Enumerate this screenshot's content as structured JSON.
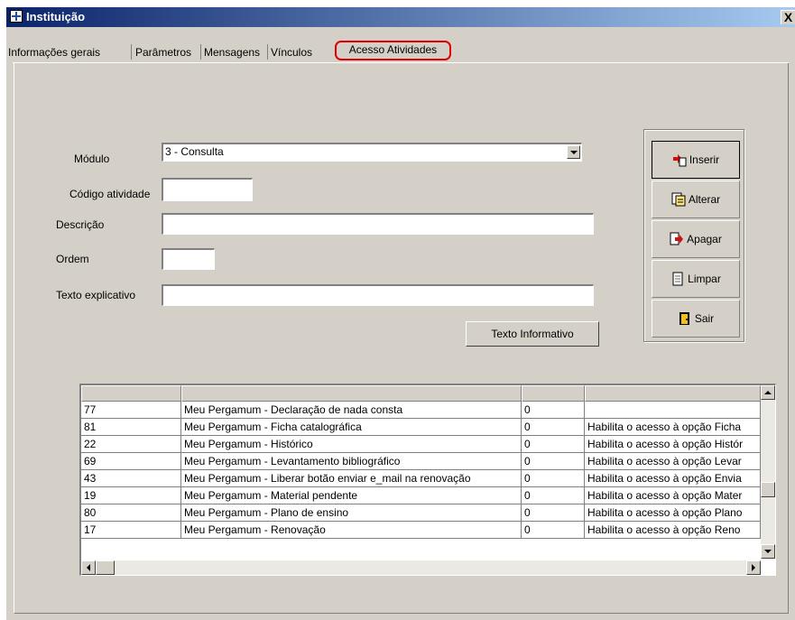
{
  "window": {
    "title": "Instituição",
    "close_label": "X"
  },
  "tabs": [
    {
      "label": "Informações gerais"
    },
    {
      "label": "Parâmetros"
    },
    {
      "label": "Mensagens"
    },
    {
      "label": "Vínculos"
    },
    {
      "label": "Acesso Atividades"
    }
  ],
  "form": {
    "modulo_label": "Módulo",
    "modulo_value": "3 - Consulta",
    "codigo_label": "Código atividade",
    "codigo_value": "",
    "descricao_label": "Descrição",
    "descricao_value": "",
    "ordem_label": "Ordem",
    "ordem_value": "",
    "texto_label": "Texto explicativo",
    "texto_value": "",
    "texto_informativo_button": "Texto Informativo"
  },
  "actions": [
    {
      "label": "Inserir",
      "icon": "insert-icon"
    },
    {
      "label": "Alterar",
      "icon": "edit-icon"
    },
    {
      "label": "Apagar",
      "icon": "delete-icon"
    },
    {
      "label": "Limpar",
      "icon": "clear-icon"
    },
    {
      "label": "Sair",
      "icon": "exit-door-icon"
    }
  ],
  "grid": {
    "headers": [
      "",
      "",
      "",
      ""
    ],
    "rows": [
      [
        "77",
        "Meu Pergamum  - Declaração de nada consta",
        "0",
        ""
      ],
      [
        "81",
        "Meu Pergamum  - Ficha catalográfica",
        "0",
        "Habilita o acesso à opção Ficha"
      ],
      [
        "22",
        "Meu Pergamum  - Histórico",
        "0",
        "Habilita o acesso à opção Histór"
      ],
      [
        "69",
        "Meu Pergamum  - Levantamento bibliográfico",
        "0",
        "Habilita o acesso à opção Levar"
      ],
      [
        "43",
        "Meu Pergamum  - Liberar botão enviar e_mail na renovação",
        "0",
        "Habilita o acesso à opção Envia"
      ],
      [
        "19",
        "Meu Pergamum  - Material pendente",
        "0",
        "Habilita o acesso à opção Mater"
      ],
      [
        "80",
        "Meu Pergamum  - Plano de ensino",
        "0",
        "Habilita o acesso à opção Plano"
      ],
      [
        "17",
        "Meu Pergamum  - Renovação",
        "0",
        "Habilita o acesso à opção Reno"
      ]
    ]
  },
  "colors": {
    "titlebar": "#0a246a",
    "highlight": "#e00000",
    "face": "#d4d0c8"
  }
}
